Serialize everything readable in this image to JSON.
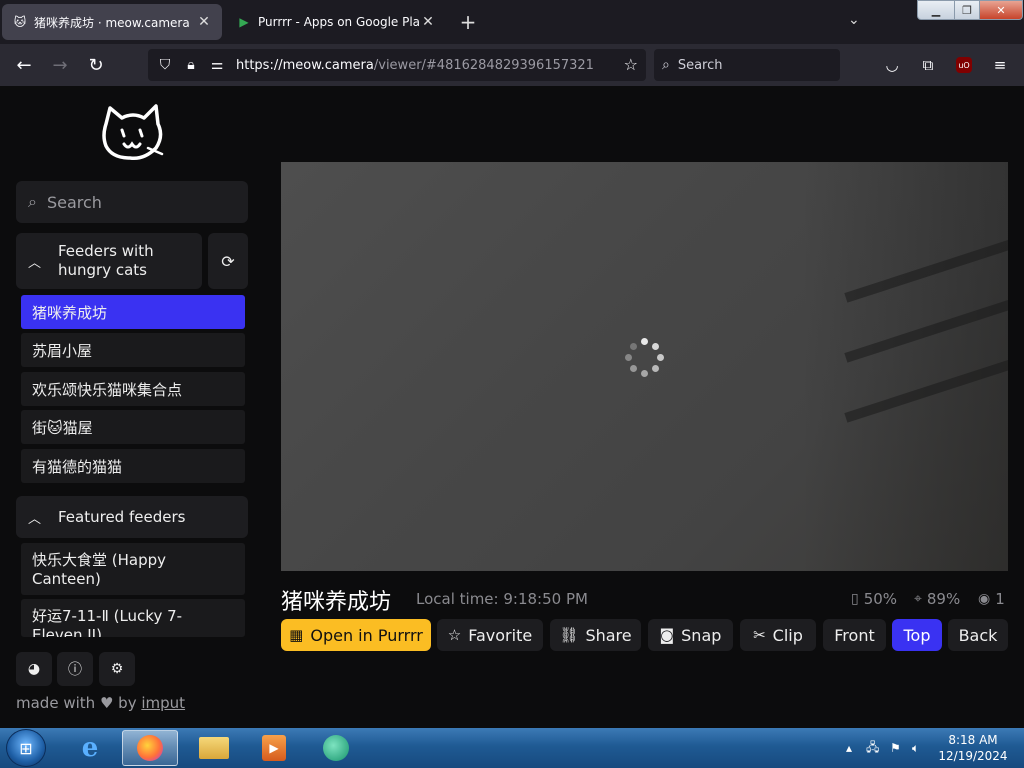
{
  "browser": {
    "tabs": [
      {
        "title": "猪咪养成坊 · meow.camera",
        "icon": "cat-favicon"
      },
      {
        "title": "Purrrr - Apps on Google Play",
        "icon": "google-play-favicon"
      }
    ],
    "url_host": "https://meow.camera",
    "url_path": "/viewer/#4816284829396157321",
    "search_placeholder": "Search"
  },
  "sidebar": {
    "search_placeholder": "Search",
    "groups": [
      {
        "label": "Feeders with hungry cats"
      },
      {
        "label": "Featured feeders"
      }
    ],
    "hungry_feeders": [
      "猪咪养成坊",
      "苏眉小屋",
      "欢乐颂快乐猫咪集合点",
      "街🐱猫屋",
      "有猫德的猫猫"
    ],
    "featured_feeders": [
      "快乐大食堂 (Happy Canteen)",
      "好运7-11-Ⅱ (Lucky 7-Eleven II)"
    ],
    "made_with": "made with",
    "by": "by",
    "author": "imput"
  },
  "viewer": {
    "camera_name": "猪咪养成坊",
    "local_time": "Local time: 9:18:50 PM",
    "battery": "50%",
    "signal": "89%",
    "viewers": "1"
  },
  "actions": {
    "open": "Open in Purrrr",
    "favorite": "Favorite",
    "share": "Share",
    "snap": "Snap",
    "clip": "Clip",
    "front": "Front",
    "top": "Top",
    "back": "Back"
  },
  "taskbar": {
    "time": "8:18 AM",
    "date": "12/19/2024"
  },
  "colors": {
    "accent_blue": "#3a32f2",
    "accent_yellow": "#fbbd23",
    "background": "#0c0c0d"
  }
}
